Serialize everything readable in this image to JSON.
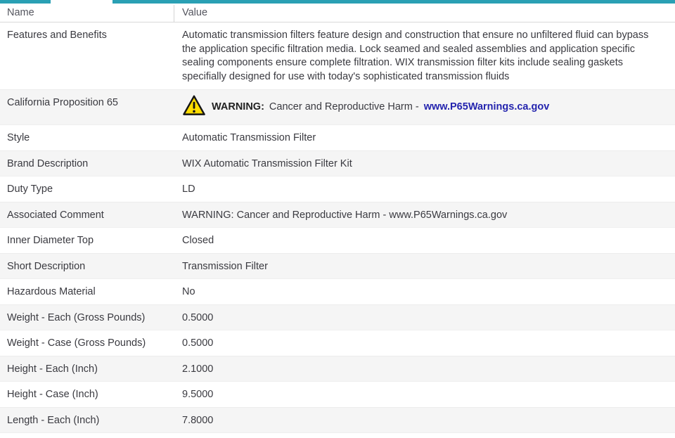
{
  "header": {
    "name_col": "Name",
    "value_col": "Value"
  },
  "colors": {
    "accent_teal": "#2aa0b4",
    "link_blue": "#2424ae",
    "alt_row_bg": "#f5f5f5",
    "warning_yellow": "#ffdd00"
  },
  "rows": [
    {
      "name": "Features and Benefits",
      "value": "Automatic transmission filters feature design and construction that ensure no unfiltered fluid can bypass the application specific filtration media. Lock seamed and sealed assemblies and application specific sealing components ensure complete filtration. WIX transmission filter kits include sealing gaskets specifially designed for use with today's sophisticated transmission fluids"
    },
    {
      "name": "California Proposition 65",
      "type": "warning",
      "icon": "warning-triangle-icon",
      "warning_label": "WARNING:",
      "warning_text": "Cancer and Reproductive Harm -",
      "link": "www.P65Warnings.ca.gov"
    },
    {
      "name": "Style",
      "value": "Automatic Transmission Filter"
    },
    {
      "name": "Brand Description",
      "value": "WIX Automatic Transmission Filter Kit"
    },
    {
      "name": "Duty Type",
      "value": "LD"
    },
    {
      "name": "Associated Comment",
      "value": "WARNING: Cancer and Reproductive Harm - www.P65Warnings.ca.gov"
    },
    {
      "name": "Inner Diameter Top",
      "value": "Closed"
    },
    {
      "name": "Short Description",
      "value": "Transmission Filter"
    },
    {
      "name": "Hazardous Material",
      "value": "No"
    },
    {
      "name": "Weight - Each (Gross Pounds)",
      "value": "0.5000"
    },
    {
      "name": "Weight - Case (Gross Pounds)",
      "value": "0.5000"
    },
    {
      "name": "Height - Each (Inch)",
      "value": "2.1000"
    },
    {
      "name": "Height - Case (Inch)",
      "value": "9.5000"
    },
    {
      "name": "Length - Each (Inch)",
      "value": "7.8000"
    }
  ]
}
